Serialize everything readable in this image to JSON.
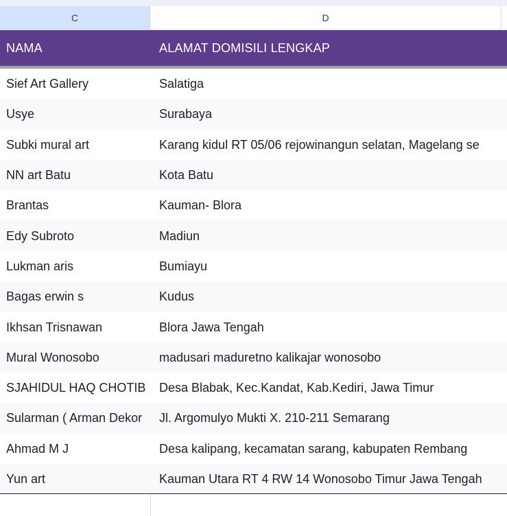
{
  "column_headers": {
    "c": "C",
    "d": "D"
  },
  "header": {
    "nama": "NAMA",
    "alamat": "ALAMAT DOMISILI LENGKAP"
  },
  "rows": [
    {
      "nama": "Sief Art Gallery",
      "alamat": "Salatiga"
    },
    {
      "nama": "Usye",
      "alamat": "Surabaya"
    },
    {
      "nama": "Subki mural art",
      "alamat": "Karang kidul RT 05/06 rejowinangun selatan, Magelang se"
    },
    {
      "nama": "NN art Batu",
      "alamat": "Kota Batu"
    },
    {
      "nama": "Brantas",
      "alamat": "Kauman- Blora"
    },
    {
      "nama": "Edy Subroto",
      "alamat": "Madiun"
    },
    {
      "nama": "Lukman aris",
      "alamat": "Bumiayu"
    },
    {
      "nama": "Bagas erwin s",
      "alamat": "Kudus"
    },
    {
      "nama": "Ikhsan Trisnawan",
      "alamat": "Blora Jawa Tengah"
    },
    {
      "nama": "Mural Wonosobo",
      "alamat": "madusari maduretno kalikajar wonosobo"
    },
    {
      "nama": "SJAHIDUL HAQ CHOTIB",
      "alamat": "Desa Blabak, Kec.Kandat, Kab.Kediri, Jawa Timur"
    },
    {
      "nama": "Sularman ( Arman Dekor",
      "alamat": "Jl. Argomulyo Mukti X. 210-211 Semarang"
    },
    {
      "nama": "Ahmad M J",
      "alamat": "Desa kalipang, kecamatan sarang, kabupaten Rembang"
    },
    {
      "nama": "Yun art",
      "alamat": "Kauman Utara RT 4 RW 14 Wonosobo Timur Jawa Tengah"
    }
  ],
  "colors": {
    "header_bg": "#5c3d8c",
    "selected_column_header": "#d3e3fd",
    "row_alt_bg": "#f8f9fb"
  }
}
